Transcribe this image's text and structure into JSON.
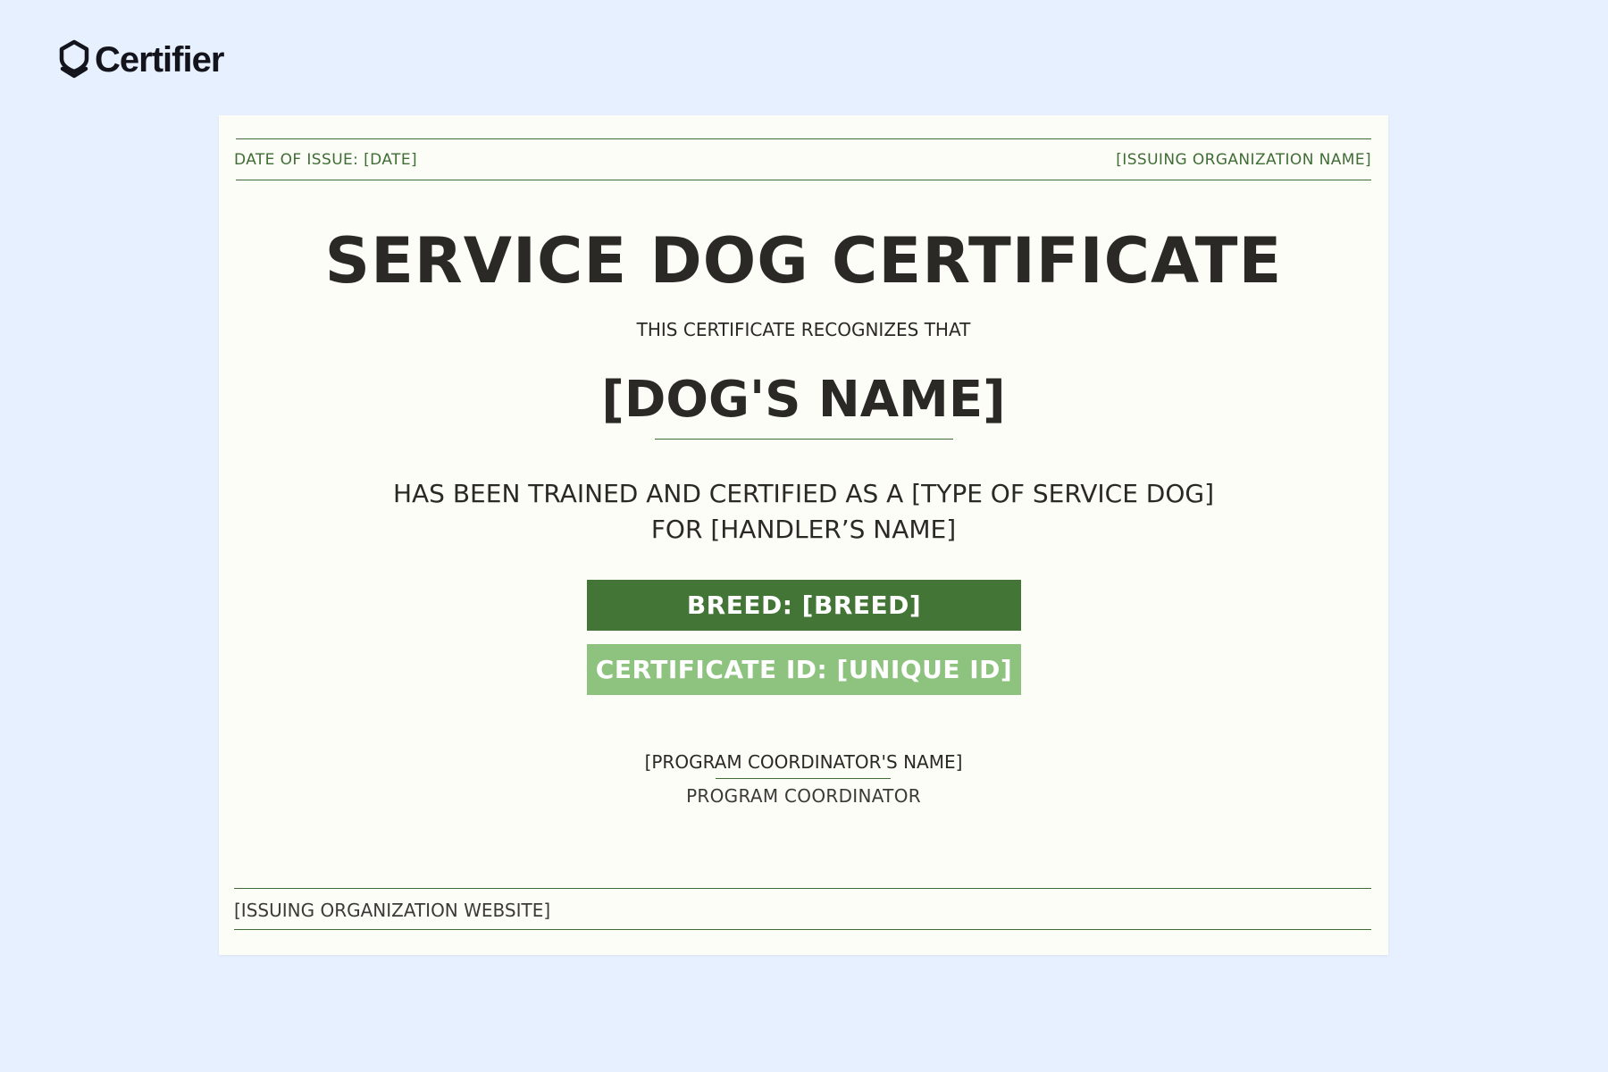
{
  "brand": {
    "name": "Certifier",
    "icon": "certifier-shield-logo-icon"
  },
  "certificate": {
    "date_of_issue": "DATE OF ISSUE: [DATE]",
    "issuing_org": "[ISSUING ORGANIZATION NAME]",
    "title": "SERVICE DOG CERTIFICATE",
    "recognizes": "THIS CERTIFICATE RECOGNIZES THAT",
    "dog_name": "[DOG'S NAME]",
    "statement_line1": "HAS BEEN TRAINED AND CERTIFIED AS A [TYPE OF SERVICE DOG]",
    "statement_line2": "FOR [HANDLER’S NAME]",
    "breed": "BREED: [BREED]",
    "certificate_id": "CERTIFICATE ID: [UNIQUE ID]",
    "coordinator_name": "[PROGRAM COORDINATOR'S NAME]",
    "coordinator_role": "PROGRAM COORDINATOR",
    "website": "[ISSUING ORGANIZATION WEBSITE]"
  },
  "colors": {
    "page_background": "#e6f0fe",
    "paper": "#fdfdf8",
    "accent_green": "#3f6d35",
    "breed_band": "#437536",
    "id_band": "#8dc27f",
    "text_dark": "#2b2925"
  }
}
